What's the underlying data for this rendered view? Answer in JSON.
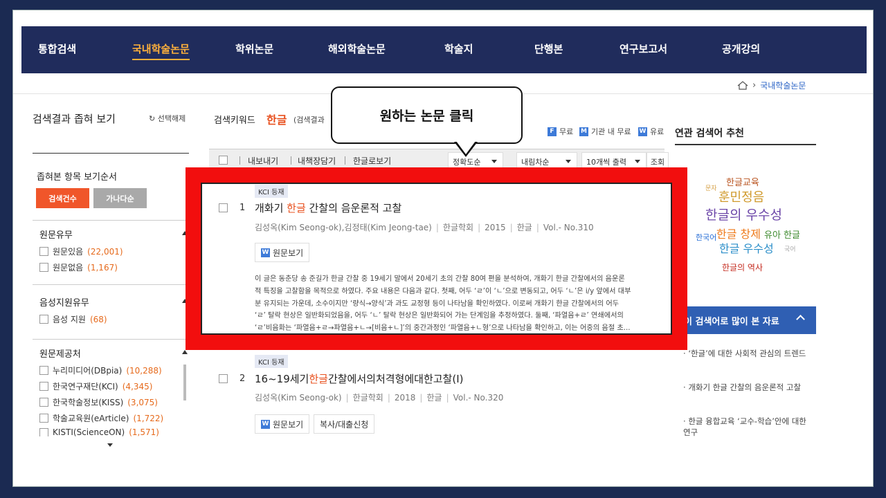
{
  "nav": {
    "items": [
      "통합검색",
      "국내학술논문",
      "학위논문",
      "해외학술논문",
      "학술지",
      "단행본",
      "연구보고서",
      "공개강의"
    ],
    "active_index": 1
  },
  "breadcrumb": {
    "current": "국내학술논문"
  },
  "sidebar": {
    "title": "검색결과 좁혀 보기",
    "reset": "선택해제",
    "order_label": "좁혀본 항목 보기순서",
    "sort_buttons": [
      "검색건수",
      "가나다순"
    ],
    "groups": [
      {
        "title": "원문유무",
        "items": [
          {
            "label": "원문있음",
            "count": "(22,001)"
          },
          {
            "label": "원문없음",
            "count": "(1,167)"
          }
        ]
      },
      {
        "title": "음성지원유무",
        "items": [
          {
            "label": "음성 지원",
            "count": "(68)"
          }
        ]
      },
      {
        "title": "원문제공처",
        "items": [
          {
            "label": "누리미디어(DBpia)",
            "count": "(10,288)"
          },
          {
            "label": "한국연구재단(KCI)",
            "count": "(4,345)"
          },
          {
            "label": "한국학술정보(KISS)",
            "count": "(3,075)"
          },
          {
            "label": "학술교육원(eArticle)",
            "count": "(1,722)"
          },
          {
            "label": "KISTI(ScienceON)",
            "count": "(1,571)"
          }
        ]
      }
    ]
  },
  "search": {
    "keyword_label": "검색키워드",
    "keyword": "한글",
    "note": "(검색결과",
    "legend": [
      {
        "badge": "F",
        "label": "무료",
        "color": "#3d7ad8"
      },
      {
        "badge": "M",
        "label": "기관 내 무료",
        "color": "#3d7ad8"
      },
      {
        "badge": "W",
        "label": "유료",
        "color": "#3d7ad8"
      }
    ]
  },
  "toolbar": {
    "actions": [
      "내보내기",
      "내책장담기",
      "한글로보기"
    ],
    "sort": "정확도순",
    "order": "내림차순",
    "per_page": "10개씩 출력",
    "go": "조회"
  },
  "callout": "원하는 논문 클릭",
  "results": [
    {
      "badge": "KCI 등재",
      "num": "1",
      "title_pre": "개화기 ",
      "title_hl": "한글",
      "title_post": " 간찰의 음운론적 고찰",
      "meta": [
        "김성옥(Kim Seong-ok),김정태(Kim Jeong-tae)",
        "한글학회",
        "2015",
        "한글",
        "Vol.- No.310"
      ],
      "buttons": [
        "원문보기"
      ],
      "abstract": [
        "이 글은 동춘당 송 준길가 한글 간찰 중 19세기 말에서 20세기 초의 간찰 80여 편을 분석하여, 개화기 한글 간찰에서의 음운론",
        "적 특징을 고찰함을 목적으로 하였다. 주요 내용은 다음과 같다. 첫째, 어두 ‘ㄹ’이 ‘ㄴ’으로 변동되고, 어두 ‘ㄴ’은 i/y 앞에서 대부",
        "분 유지되는 가운데, 소수이지만 ‘량식→양식’과 과도 교정형 등이 나타남을 확인하였다. 이로써 개화기 한글 간찰에서의 어두",
        "‘ㄹ’ 탈락 현상은 일반화되었음을, 어두 ‘ㄴ’ 탈락 현상은 일반화되어 가는 단계임을 추정하였다. 둘째, ‘파열음+ㄹ’ 연쇄에서의",
        "‘ㄹ’비음화는 ‘파열음+ㄹ→파열음+ㄴ→[비음+ㄴ]’의 중간과정인 ‘파열음+ㄴ형’으로 나타남을 확인하고, 이는 어중의 음절 초..."
      ]
    },
    {
      "badge": "KCI 등재",
      "num": "2",
      "title_pre": "16~19세기",
      "title_hl": "한글",
      "title_post": "간찰에서의처격형에대한고찰(Ⅰ)",
      "meta": [
        "김성옥(Kim Seong-ok)",
        "한글학회",
        "2018",
        "한글",
        "Vol.- No.320"
      ],
      "buttons": [
        "원문보기",
        "복사/대출신청"
      ]
    }
  ],
  "related": {
    "title": "연관 검색어 추천",
    "words": [
      "한글교육",
      "문자",
      "훈민정음",
      "한글의 우수성",
      "한국어",
      "한글 창제",
      "유아 한글",
      "한글 우수성",
      "국어",
      "한글의 역사"
    ]
  },
  "most_viewed": {
    "title": "이 검색어로 많이 본 자료",
    "items": [
      "‘한글’에 대한 사회적 관심의 트렌드",
      "개화기 한글 간찰의 음운론적 고찰",
      "한글 융합교육 ‘교수-학습’안에 대한 연구"
    ]
  }
}
